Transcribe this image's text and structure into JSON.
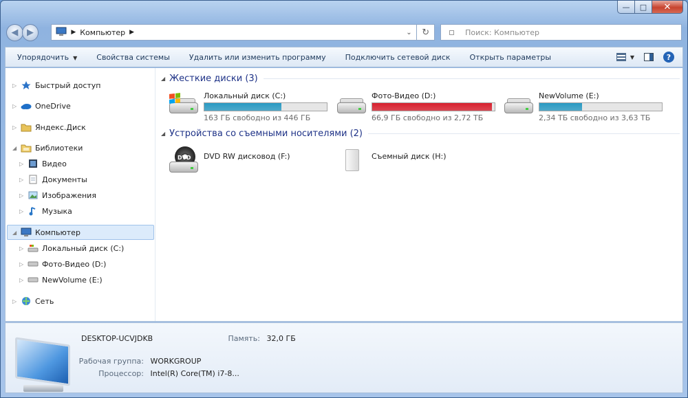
{
  "window": {
    "caption": {
      "minimize": "—",
      "maximize": "□",
      "close": "✕"
    }
  },
  "nav": {
    "back": "◀",
    "forward": "▶",
    "address": {
      "crumbs": [
        "Компьютер"
      ]
    },
    "search": {
      "placeholder": "Поиск: Компьютер"
    }
  },
  "toolbar": {
    "items": [
      "Упорядочить",
      "Свойства системы",
      "Удалить или изменить программу",
      "Подключить сетевой диск",
      "Открыть параметры"
    ]
  },
  "tree": {
    "items": [
      {
        "label": "Быстрый доступ",
        "icon": "star-icon",
        "level": 0,
        "expander": "▷"
      },
      {
        "label": "OneDrive",
        "icon": "cloud-icon",
        "level": 0,
        "expander": "▷"
      },
      {
        "label": "Яндекс.Диск",
        "icon": "folder-icon",
        "level": 0,
        "expander": "▷"
      },
      {
        "label": "Библиотеки",
        "icon": "libraries-icon",
        "level": 0,
        "expander": "◢"
      },
      {
        "label": "Видео",
        "icon": "video-icon",
        "level": 1,
        "expander": "▷"
      },
      {
        "label": "Документы",
        "icon": "document-icon",
        "level": 1,
        "expander": "▷"
      },
      {
        "label": "Изображения",
        "icon": "image-icon",
        "level": 1,
        "expander": "▷"
      },
      {
        "label": "Музыка",
        "icon": "music-icon",
        "level": 1,
        "expander": "▷"
      },
      {
        "label": "Компьютер",
        "icon": "computer-icon",
        "level": 0,
        "expander": "◢",
        "selected": true
      },
      {
        "label": "Локальный диск (C:)",
        "icon": "drive-c-icon",
        "level": 1,
        "expander": "▷"
      },
      {
        "label": "Фото-Видео (D:)",
        "icon": "drive-icon",
        "level": 1,
        "expander": "▷"
      },
      {
        "label": "NewVolume (E:)",
        "icon": "drive-icon",
        "level": 1,
        "expander": "▷"
      },
      {
        "label": "Сеть",
        "icon": "network-icon",
        "level": 0,
        "expander": "▷"
      }
    ]
  },
  "groups": {
    "hard_drives": {
      "title": "Жесткие диски (3)"
    },
    "removable": {
      "title": "Устройства со съемными носителями (2)"
    }
  },
  "drives": [
    {
      "name": "Локальный диск (C:)",
      "free": "163 ГБ свободно из 446 ГБ",
      "used_fraction": 0.63,
      "bar_color": "#2a9ac3"
    },
    {
      "name": "Фото-Видео (D:)",
      "free": "66,9 ГБ свободно из 2,72 ТБ",
      "used_fraction": 0.98,
      "bar_color": "#d8202e"
    },
    {
      "name": "NewVolume (E:)",
      "free": "2,34 ТБ свободно из 3,63 ТБ",
      "used_fraction": 0.35,
      "bar_color": "#2a9ac3"
    }
  ],
  "removable_devices": [
    {
      "name": "DVD RW дисковод (F:)",
      "badge": "DVD"
    },
    {
      "name": "Съемный диск (H:)"
    }
  ],
  "details": {
    "computer_name": "DESKTOP-UCVJDKB",
    "memory_label": "Память:",
    "memory_value": "32,0 ГБ",
    "workgroup_label": "Рабочая группа:",
    "workgroup_value": "WORKGROUP",
    "cpu_label": "Процессор:",
    "cpu_value": "Intel(R) Core(TM) i7-8..."
  }
}
